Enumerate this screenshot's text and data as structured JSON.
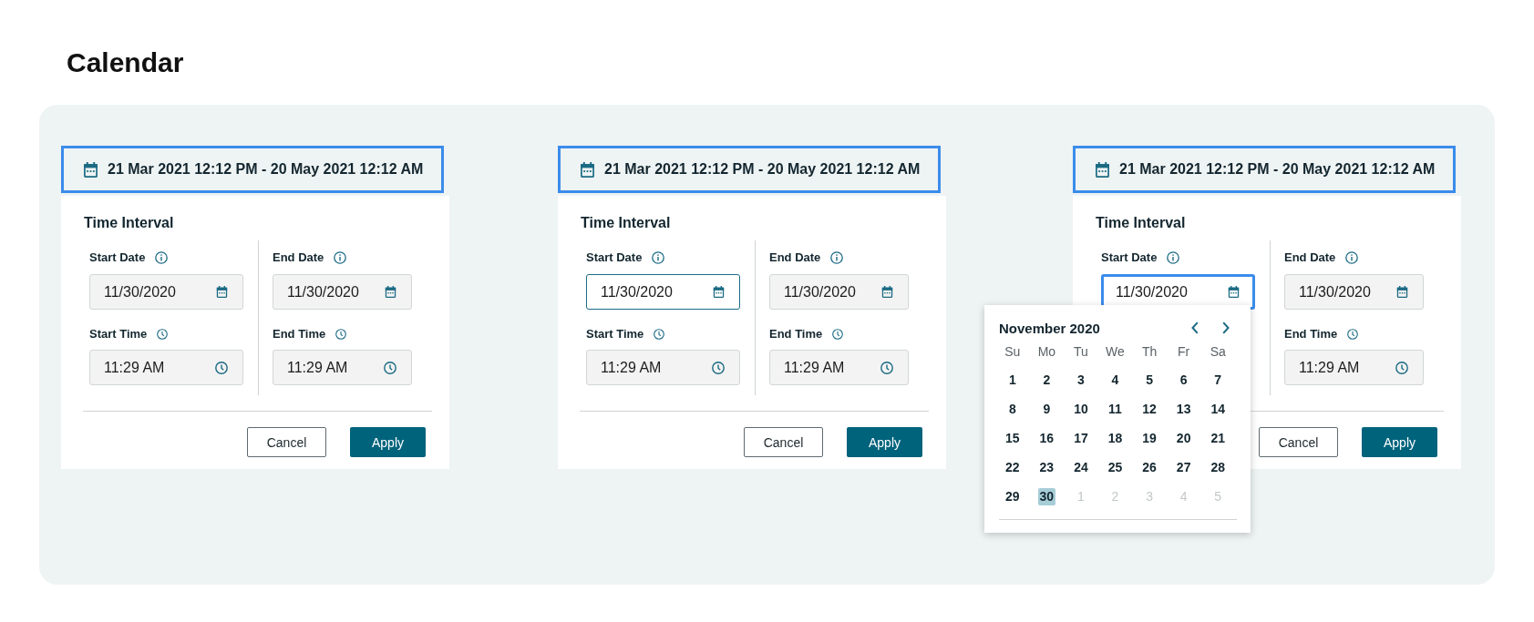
{
  "page": {
    "title": "Calendar"
  },
  "panels": [
    {
      "range_button": {
        "label": "21 Mar 2021 12:12 PM - 20 May 2021 12:12 AM",
        "focused": true
      },
      "popover": {
        "title": "Time Interval",
        "columns": [
          {
            "fields": [
              {
                "kind": "date",
                "label": "Start Date",
                "value": "11/30/2020",
                "focused": false
              },
              {
                "kind": "time",
                "label": "Start Time",
                "value": "11:29 AM",
                "focused": false
              }
            ]
          },
          {
            "fields": [
              {
                "kind": "date",
                "label": "End Date",
                "value": "11/30/2020",
                "focused": false
              },
              {
                "kind": "time",
                "label": "End Time",
                "value": "11:29 AM",
                "focused": false
              }
            ]
          }
        ],
        "buttons": [
          {
            "label": "Cancel",
            "kind": "secondary"
          },
          {
            "label": "Apply",
            "kind": "primary"
          }
        ]
      }
    },
    {
      "range_button": {
        "label": "21 Mar 2021 12:12 PM - 20 May 2021 12:12 AM",
        "focused": true
      },
      "popover": {
        "title": "Time Interval",
        "columns": [
          {
            "fields": [
              {
                "kind": "date",
                "label": "Start Date",
                "value": "11/30/2020",
                "focused": true
              },
              {
                "kind": "time",
                "label": "Start Time",
                "value": "11:29 AM",
                "focused": false
              }
            ]
          },
          {
            "fields": [
              {
                "kind": "date",
                "label": "End Date",
                "value": "11/30/2020",
                "focused": false
              },
              {
                "kind": "time",
                "label": "End Time",
                "value": "11:29 AM",
                "focused": false
              }
            ]
          }
        ],
        "buttons": [
          {
            "label": "Cancel",
            "kind": "secondary"
          },
          {
            "label": "Apply",
            "kind": "primary"
          }
        ]
      }
    },
    {
      "range_button": {
        "label": "21 Mar 2021 12:12 PM - 20 May 2021 12:12 AM",
        "focused": true
      },
      "popover": {
        "title": "Time Interval",
        "columns": [
          {
            "fields": [
              {
                "kind": "date",
                "label": "Start Date",
                "value": "11/30/2020",
                "focused": true
              }
            ]
          },
          {
            "fields": [
              {
                "kind": "date",
                "label": "End Date",
                "value": "11/30/2020",
                "focused": false
              },
              {
                "kind": "time",
                "label": "End Time",
                "value": "11:29 AM",
                "focused": false
              }
            ]
          }
        ],
        "buttons": [
          {
            "label": "Cancel",
            "kind": "secondary"
          },
          {
            "label": "Apply",
            "kind": "primary"
          }
        ]
      },
      "date_picker": {
        "month": "November 2020",
        "weekdays": [
          "Su",
          "Mo",
          "Tu",
          "We",
          "Th",
          "Fr",
          "Sa"
        ],
        "days": [
          {
            "label": "1",
            "in_month": true,
            "selected": false
          },
          {
            "label": "2",
            "in_month": true,
            "selected": false
          },
          {
            "label": "3",
            "in_month": true,
            "selected": false
          },
          {
            "label": "4",
            "in_month": true,
            "selected": false
          },
          {
            "label": "5",
            "in_month": true,
            "selected": false
          },
          {
            "label": "6",
            "in_month": true,
            "selected": false
          },
          {
            "label": "7",
            "in_month": true,
            "selected": false
          },
          {
            "label": "8",
            "in_month": true,
            "selected": false
          },
          {
            "label": "9",
            "in_month": true,
            "selected": false
          },
          {
            "label": "10",
            "in_month": true,
            "selected": false
          },
          {
            "label": "11",
            "in_month": true,
            "selected": false
          },
          {
            "label": "12",
            "in_month": true,
            "selected": false
          },
          {
            "label": "13",
            "in_month": true,
            "selected": false
          },
          {
            "label": "14",
            "in_month": true,
            "selected": false
          },
          {
            "label": "15",
            "in_month": true,
            "selected": false
          },
          {
            "label": "16",
            "in_month": true,
            "selected": false
          },
          {
            "label": "17",
            "in_month": true,
            "selected": false
          },
          {
            "label": "18",
            "in_month": true,
            "selected": false
          },
          {
            "label": "19",
            "in_month": true,
            "selected": false
          },
          {
            "label": "20",
            "in_month": true,
            "selected": false
          },
          {
            "label": "21",
            "in_month": true,
            "selected": false
          },
          {
            "label": "22",
            "in_month": true,
            "selected": false
          },
          {
            "label": "23",
            "in_month": true,
            "selected": false
          },
          {
            "label": "24",
            "in_month": true,
            "selected": false
          },
          {
            "label": "25",
            "in_month": true,
            "selected": false
          },
          {
            "label": "26",
            "in_month": true,
            "selected": false
          },
          {
            "label": "27",
            "in_month": true,
            "selected": false
          },
          {
            "label": "28",
            "in_month": true,
            "selected": false
          },
          {
            "label": "29",
            "in_month": true,
            "selected": false
          },
          {
            "label": "30",
            "in_month": true,
            "selected": true
          },
          {
            "label": "1",
            "in_month": false,
            "selected": false
          },
          {
            "label": "2",
            "in_month": false,
            "selected": false
          },
          {
            "label": "3",
            "in_month": false,
            "selected": false
          },
          {
            "label": "4",
            "in_month": false,
            "selected": false
          },
          {
            "label": "5",
            "in_month": false,
            "selected": false
          }
        ]
      }
    }
  ]
}
